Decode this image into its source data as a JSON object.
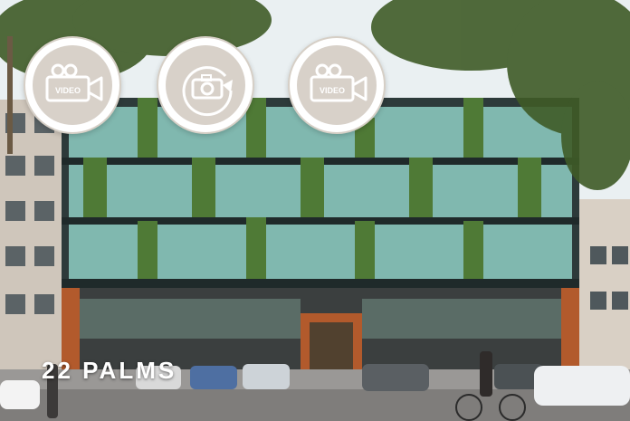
{
  "project": {
    "name": "22 PALMS"
  },
  "media_buttons": [
    {
      "icon": "video-camera-icon",
      "label": "VIDEO"
    },
    {
      "icon": "camera-360-icon"
    },
    {
      "icon": "video-camera-icon",
      "label": "VIDEO"
    }
  ],
  "colors": {
    "button_ring": "#d8d1c9",
    "icon_stroke": "#ffffff",
    "title": "#ffffff"
  }
}
